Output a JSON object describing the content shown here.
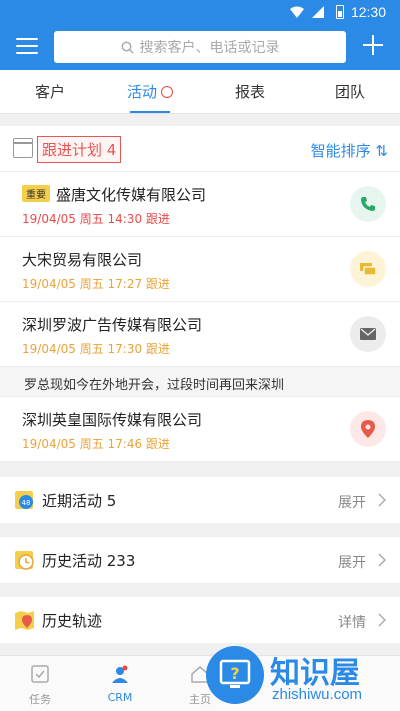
{
  "status_bar": {
    "time": "12:30"
  },
  "header": {
    "search_placeholder": "搜索客户、电话或记录"
  },
  "tabs": [
    {
      "label": "客户"
    },
    {
      "label": "活动"
    },
    {
      "label": "报表"
    },
    {
      "label": "团队"
    }
  ],
  "plan": {
    "title": "跟进计划 4",
    "sort_label": "智能排序 ⇅"
  },
  "items": [
    {
      "tag": "重要",
      "name": "盛唐文化传媒有限公司",
      "meta": "19/04/05 周五 14:30 跟进",
      "action_icon": "phone-icon"
    },
    {
      "name": "大宋贸易有限公司",
      "meta": "19/04/05 周五 17:27 跟进",
      "action_icon": "message-icon"
    },
    {
      "name": "深圳罗波广告传媒有限公司",
      "meta": "19/04/05 周五 17:30 跟进",
      "action_icon": "mail-icon"
    },
    {
      "name": "深圳英皇国际传媒有限公司",
      "meta": "19/04/05 周五 17:46 跟进",
      "action_icon": "location-icon"
    }
  ],
  "note": "罗总现如今在外地开会，过段时间再回来深圳",
  "sections": [
    {
      "label": "近期活动 5",
      "right": "展开"
    },
    {
      "label": "历史活动 233",
      "right": "展开"
    },
    {
      "label": "历史轨迹",
      "right": "详情"
    }
  ],
  "bottom_nav": [
    {
      "label": "任务"
    },
    {
      "label": "CRM"
    },
    {
      "label": "主页"
    }
  ],
  "watermark": {
    "text": "知识屋",
    "url": "zhishiwu.com"
  },
  "colors": {
    "brand": "#2b8ae6",
    "alert": "#e84a4a",
    "followup": "#e8a33a"
  }
}
